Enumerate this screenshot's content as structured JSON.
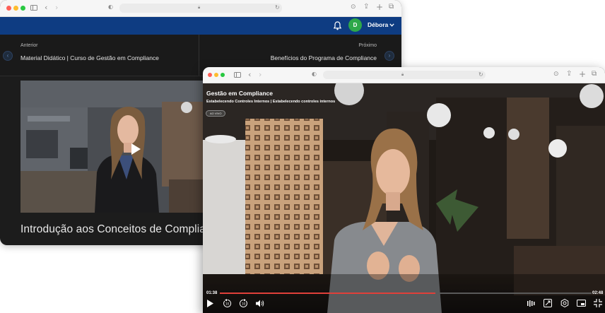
{
  "back_window": {
    "header": {
      "user_initial": "D",
      "user_name": "Débora",
      "user_dropdown_icon": "chevron-down-icon",
      "bell_icon": "bell-icon"
    },
    "prev_lesson": {
      "label": "Anterior",
      "title": "Material Didático | Curso de Gestão em Compliance"
    },
    "next_lesson": {
      "label": "Próximo",
      "title": "Benefícios do Programa de Compliance"
    },
    "lesson_title": "Introdução aos Conceitos de Compliance"
  },
  "front_window": {
    "video": {
      "course_title": "Gestão em Compliance",
      "lesson_subtitle": "Estabelecendo Controles Internos | Estabelecendo controles internos",
      "badge": "AO VIVO",
      "current_time": "01:38",
      "duration": "02:48",
      "progress": 0.58
    }
  },
  "colors": {
    "nav_blue": "#0e3c82",
    "avatar_green": "#2ea84a",
    "progress_red": "#e0403a"
  }
}
